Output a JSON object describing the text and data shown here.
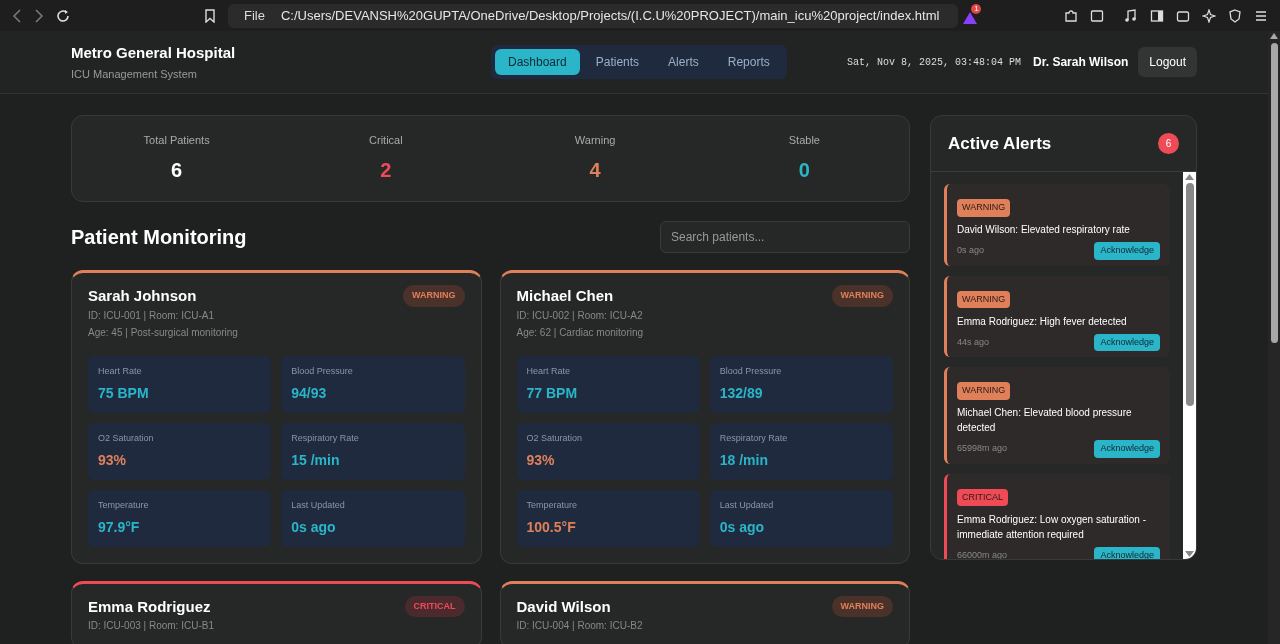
{
  "browser": {
    "file_label": "File",
    "url": "C:/Users/DEVANSH%20GUPTA/OneDrive/Desktop/Projects/(I.C.U%20PROJECT)/main_icu%20project/index.html",
    "notification_count": "1"
  },
  "header": {
    "title": "Metro General Hospital",
    "subtitle": "ICU Management System",
    "nav": [
      {
        "label": "Dashboard",
        "selected": true
      },
      {
        "label": "Patients",
        "selected": false
      },
      {
        "label": "Alerts",
        "selected": false
      },
      {
        "label": "Reports",
        "selected": false
      }
    ],
    "datetime": "Sat, Nov 8, 2025, 03:48:04 PM",
    "user": "Dr. Sarah Wilson",
    "logout": "Logout"
  },
  "summary": [
    {
      "label": "Total Patients",
      "value": "6",
      "kind": "total"
    },
    {
      "label": "Critical",
      "value": "2",
      "kind": "critical"
    },
    {
      "label": "Warning",
      "value": "4",
      "kind": "warning"
    },
    {
      "label": "Stable",
      "value": "0",
      "kind": "stable"
    }
  ],
  "monitoring": {
    "title": "Patient Monitoring",
    "search_placeholder": "Search patients..."
  },
  "patients": [
    {
      "name": "Sarah Johnson",
      "kind": "warning",
      "status_label": "WARNING",
      "id_line": "ID: ICU-001 | Room: ICU-A1",
      "info_line": "Age: 45 | Post-surgical monitoring",
      "vitals": [
        {
          "label": "Heart Rate",
          "value": "75 BPM",
          "alert": false
        },
        {
          "label": "Blood Pressure",
          "value": "94/93",
          "alert": false
        },
        {
          "label": "O2 Saturation",
          "value": "93%",
          "alert": true
        },
        {
          "label": "Respiratory Rate",
          "value": "15 /min",
          "alert": false
        },
        {
          "label": "Temperature",
          "value": "97.9°F",
          "alert": false
        },
        {
          "label": "Last Updated",
          "value": "0s ago",
          "alert": false
        }
      ]
    },
    {
      "name": "Michael Chen",
      "kind": "warning",
      "status_label": "WARNING",
      "id_line": "ID: ICU-002 | Room: ICU-A2",
      "info_line": "Age: 62 | Cardiac monitoring",
      "vitals": [
        {
          "label": "Heart Rate",
          "value": "77 BPM",
          "alert": false
        },
        {
          "label": "Blood Pressure",
          "value": "132/89",
          "alert": false
        },
        {
          "label": "O2 Saturation",
          "value": "93%",
          "alert": true
        },
        {
          "label": "Respiratory Rate",
          "value": "18 /min",
          "alert": false
        },
        {
          "label": "Temperature",
          "value": "100.5°F",
          "alert": true
        },
        {
          "label": "Last Updated",
          "value": "0s ago",
          "alert": false
        }
      ]
    },
    {
      "name": "Emma Rodriguez",
      "kind": "critical",
      "status_label": "CRITICAL",
      "id_line": "ID: ICU-003 | Room: ICU-B1"
    },
    {
      "name": "David Wilson",
      "kind": "warning",
      "status_label": "WARNING",
      "id_line": "ID: ICU-004 | Room: ICU-B2"
    }
  ],
  "alerts": {
    "title": "Active Alerts",
    "count": "6",
    "items": [
      {
        "kind": "warning",
        "label": "WARNING",
        "message": "David Wilson: Elevated respiratory rate",
        "time": "0s ago",
        "action": "Acknowledge"
      },
      {
        "kind": "warning",
        "label": "WARNING",
        "message": "Emma Rodriguez: High fever detected",
        "time": "44s ago",
        "action": "Acknowledge"
      },
      {
        "kind": "warning",
        "label": "WARNING",
        "message": "Michael Chen: Elevated blood pressure detected",
        "time": "65998m ago",
        "action": "Acknowledge"
      },
      {
        "kind": "critical",
        "label": "CRITICAL",
        "message": "Emma Rodriguez: Low oxygen saturation - immediate attention required",
        "time": "66000m ago",
        "action": "Acknowledge"
      }
    ]
  }
}
